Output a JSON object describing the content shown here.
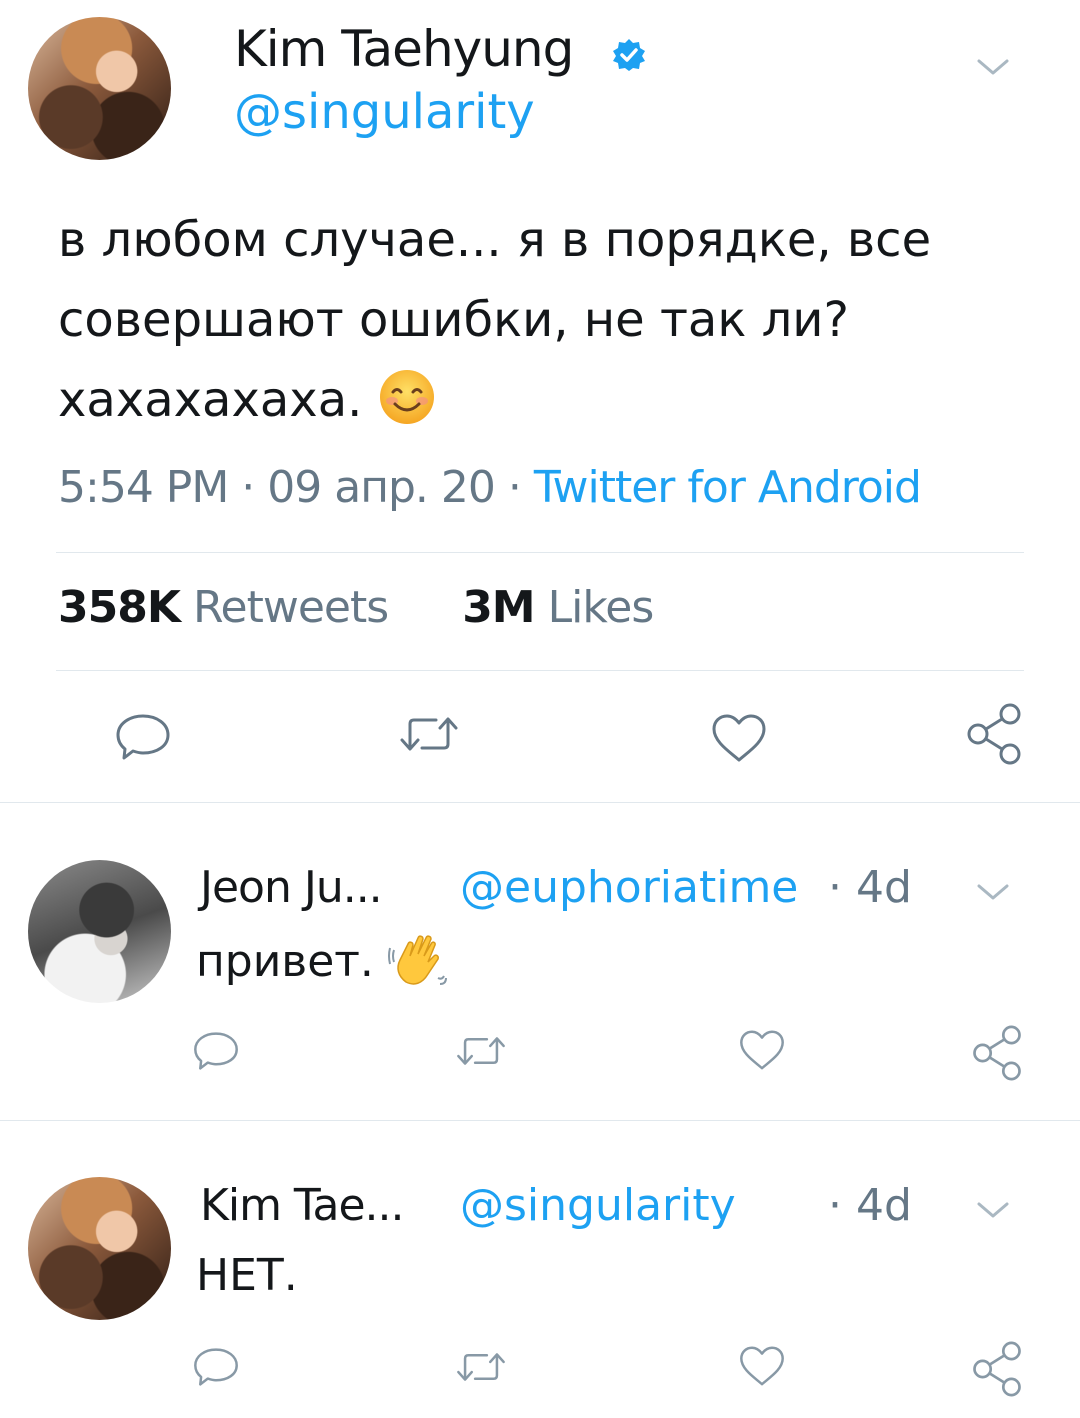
{
  "main_tweet": {
    "author_name": "Kim Taehyung",
    "author_handle": "@singularity",
    "verified_icon": "verified-badge-icon",
    "text_line1": "в любом случае... я в порядке, все",
    "text_line2": "совершают ошибки, не так ли?",
    "text_line3": "хахахахаха.",
    "text_emoji": "smiling-face-icon",
    "time": "5:54 PM",
    "date": "09 апр. 20",
    "source": "Twitter for Android",
    "separator": "·",
    "retweets_count": "358K",
    "retweets_label": "Retweets",
    "likes_count": "3M",
    "likes_label": "Likes"
  },
  "replies": [
    {
      "author_name": "Jeon Ju...",
      "author_handle": "@euphoriatime",
      "age": "· 4d",
      "text": "привет.",
      "emoji": "waving-hand-icon"
    },
    {
      "author_name": "Kim Tae...",
      "author_handle": "@singularity",
      "age": "· 4d",
      "text": "НЕТ."
    }
  ],
  "colors": {
    "accent": "#1da1f2",
    "muted": "#657786",
    "divider": "#e1e8ed",
    "text": "#14171a"
  }
}
